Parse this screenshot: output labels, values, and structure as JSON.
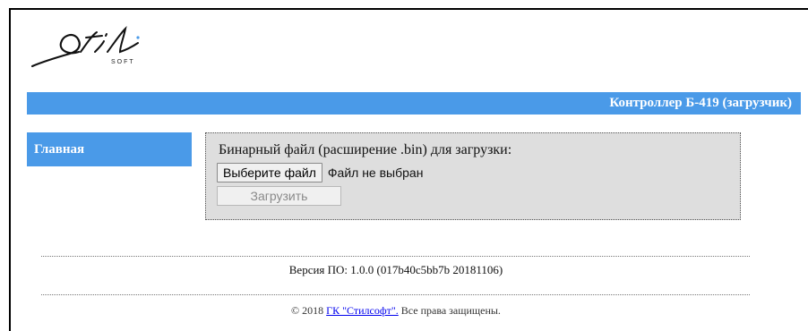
{
  "logo": {
    "script_text": "Stil",
    "small_text": "SOFT",
    "accent_color": "#4a9ae8"
  },
  "header": {
    "title": "Контроллер Б-419 (загрузчик)"
  },
  "sidebar": {
    "items": [
      {
        "label": "Главная"
      }
    ]
  },
  "upload": {
    "label": "Бинарный файл (расширение .bin) для загрузки:",
    "choose_button": "Выберите файл",
    "file_status": "Файл не выбран",
    "upload_button": "Загрузить"
  },
  "footer": {
    "version": "Версия ПО: 1.0.0 (017b40c5bb7b 20181106)",
    "copyright_prefix": "© 2018 ",
    "company_link": "ГК \"Стилсофт\".",
    "copyright_suffix": " Все права защищены."
  },
  "colors": {
    "accent": "#4a9ae8",
    "panel_bg": "#dedede"
  }
}
